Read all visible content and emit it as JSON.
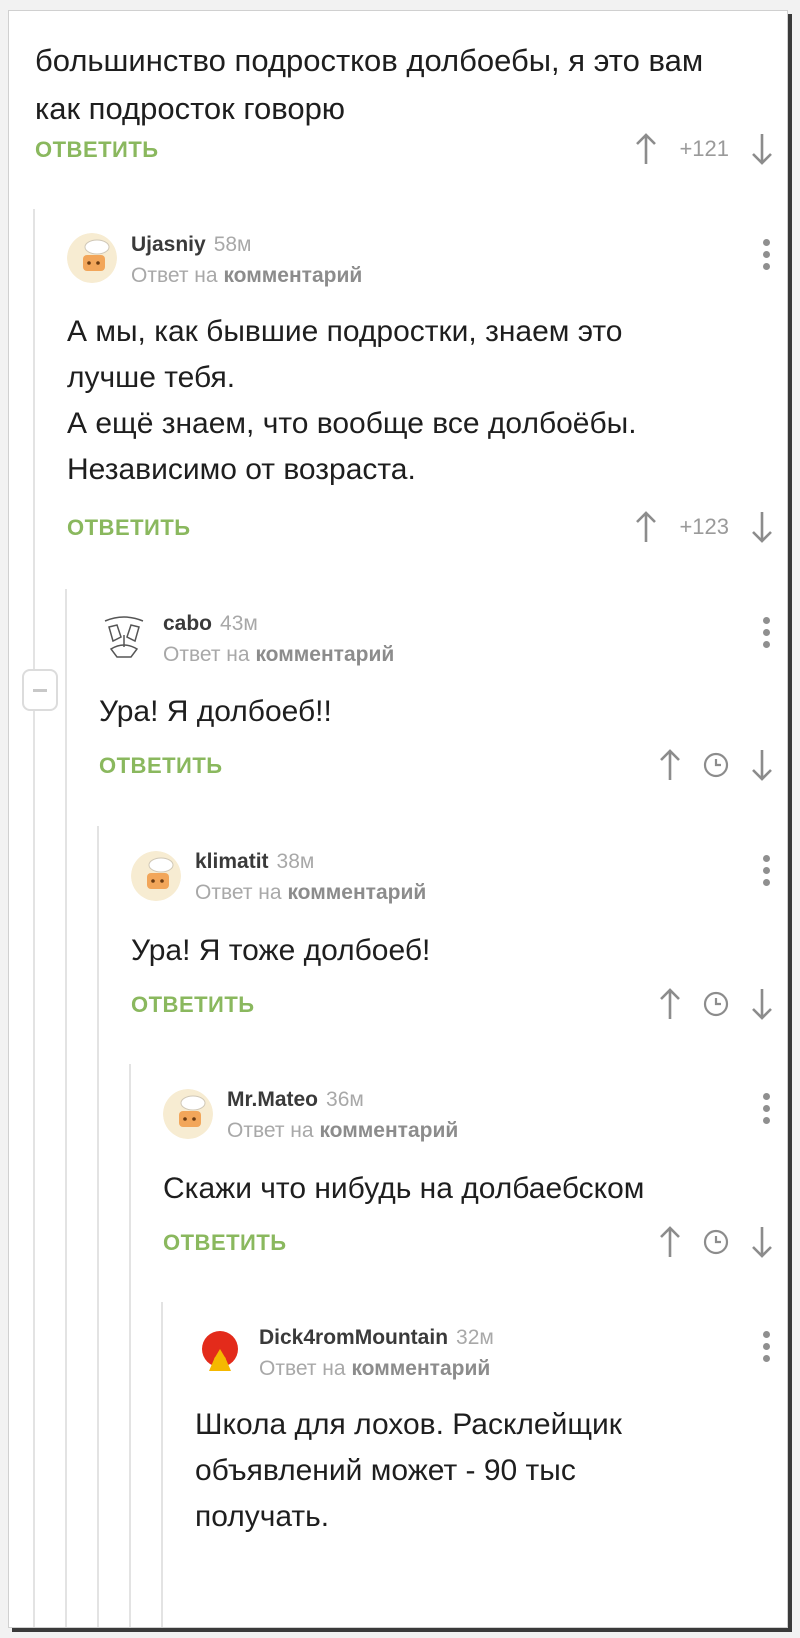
{
  "top_comment": {
    "text": "большинство подростков долбоебы, я это вам как подросток говорю",
    "reply_label": "ОТВЕТИТЬ",
    "rating": "+121"
  },
  "comments": [
    {
      "author": "Ujasniy",
      "time": "58м",
      "reply_prefix": "Ответ на",
      "reply_link": "комментарий",
      "text": "А мы, как бывшие подростки, знаем это\nлучше тебя.\nА ещё знаем, что вообще все долбоёбы.\nНезависимо от возраста.",
      "reply_label": "ОТВЕТИТЬ",
      "rating": "+123",
      "avatar": "chef-hat-avatar-icon"
    },
    {
      "author": "cabo",
      "time": "43м",
      "reply_prefix": "Ответ на",
      "reply_link": "комментарий",
      "text": "Ура! Я долбоеб!!",
      "reply_label": "ОТВЕТИТЬ",
      "rating": "",
      "avatar": "sketch-face-avatar-icon"
    },
    {
      "author": "klimatit",
      "time": "38м",
      "reply_prefix": "Ответ на",
      "reply_link": "комментарий",
      "text": "Ура! Я тоже долбоеб!",
      "reply_label": "ОТВЕТИТЬ",
      "rating": "",
      "avatar": "chef-hat-avatar-icon"
    },
    {
      "author": "Mr.Mateo",
      "time": "36м",
      "reply_prefix": "Ответ на",
      "reply_link": "комментарий",
      "text": "Скажи что нибудь на долбаебском",
      "reply_label": "ОТВЕТИТЬ",
      "rating": "",
      "avatar": "chef-hat-avatar-icon"
    },
    {
      "author": "Dick4romMountain",
      "time": "32м",
      "reply_prefix": "Ответ на",
      "reply_link": "комментарий",
      "text": "Школа для лохов. Расклейщик\nобъявлений может - 90 тыс\nполучать.",
      "avatar": "red-volcano-avatar-icon"
    }
  ],
  "colors": {
    "accent_green": "#8ab85e",
    "muted_gray": "#a8a8a8",
    "thread_line": "#e3e3e3"
  }
}
